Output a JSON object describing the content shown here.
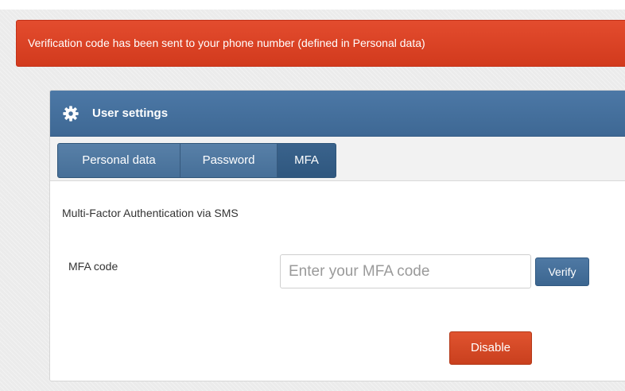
{
  "alert": {
    "message": "Verification code has been sent to your phone number (defined in Personal data)",
    "color": "#d9401f"
  },
  "panel": {
    "title": "User settings",
    "icon": "gear-icon",
    "header_color": "#446e9b"
  },
  "tabs": [
    {
      "label": "Personal data",
      "active": false
    },
    {
      "label": "Password",
      "active": false
    },
    {
      "label": "MFA",
      "active": true
    }
  ],
  "mfa": {
    "title": "Multi-Factor Authentication via SMS",
    "code_label": "MFA code",
    "code_value": "",
    "code_placeholder": "Enter your MFA code",
    "verify_label": "Verify",
    "disable_label": "Disable"
  }
}
